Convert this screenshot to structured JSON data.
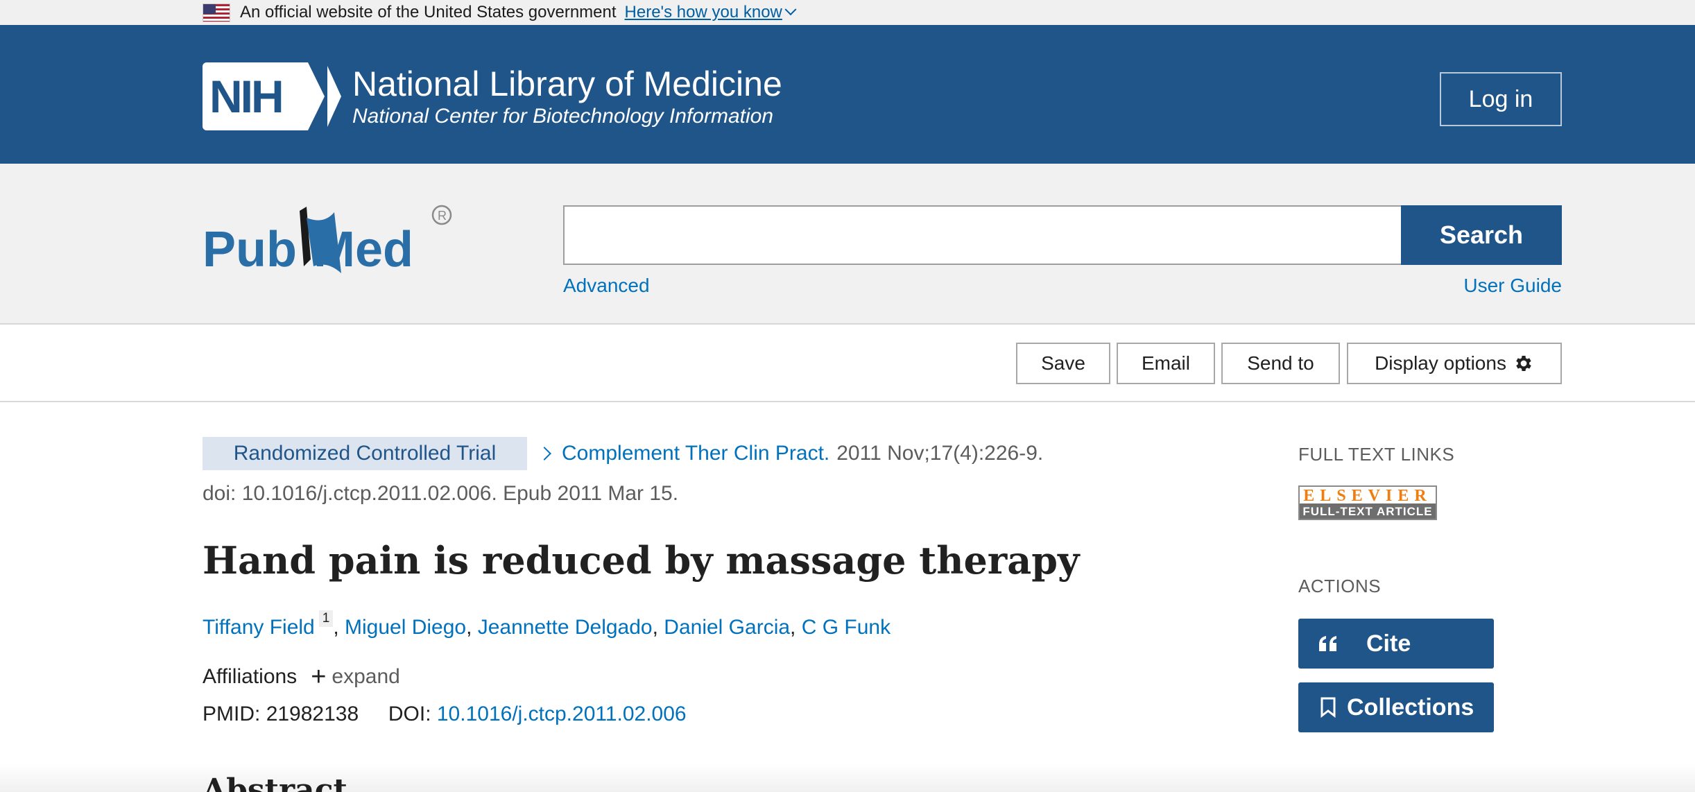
{
  "gov_banner": {
    "text": "An official website of the United States government",
    "link": "Here's how you know"
  },
  "header": {
    "logo_text": "NIH",
    "title": "National Library of Medicine",
    "subtitle": "National Center for Biotechnology Information",
    "login": "Log in"
  },
  "search": {
    "logo": "PubMed",
    "value": "",
    "placeholder": "",
    "button": "Search",
    "advanced": "Advanced",
    "user_guide": "User Guide"
  },
  "actions_bar": {
    "save": "Save",
    "email": "Email",
    "send_to": "Send to",
    "display_options": "Display options"
  },
  "article": {
    "publication_type": "Randomized Controlled Trial",
    "journal": "Complement Ther Clin Pract.",
    "citation": "2011 Nov;17(4):226-9.",
    "doi_line": "doi: 10.1016/j.ctcp.2011.02.006. Epub 2011 Mar 15.",
    "title": "Hand pain is reduced by massage therapy",
    "authors": [
      "Tiffany Field",
      "Miguel Diego",
      "Jeannette Delgado",
      "Daniel Garcia",
      "C G Funk"
    ],
    "first_author_affiliation_number": "1",
    "affiliations_label": "Affiliations",
    "expand_label": "expand",
    "pmid_label": "PMID:",
    "pmid": "21982138",
    "doi_label": "DOI:",
    "doi": "10.1016/j.ctcp.2011.02.006",
    "abstract_heading": "Abstract"
  },
  "sidebar": {
    "full_text_heading": "FULL TEXT LINKS",
    "elsevier_top": "ELSEVIER",
    "elsevier_bottom": "FULL-TEXT ARTICLE",
    "actions_heading": "ACTIONS",
    "cite": "Cite",
    "collections": "Collections"
  },
  "colors": {
    "brand_blue": "#20558a",
    "link_blue": "#0071bc",
    "banner_gray": "#f0f0f0"
  }
}
